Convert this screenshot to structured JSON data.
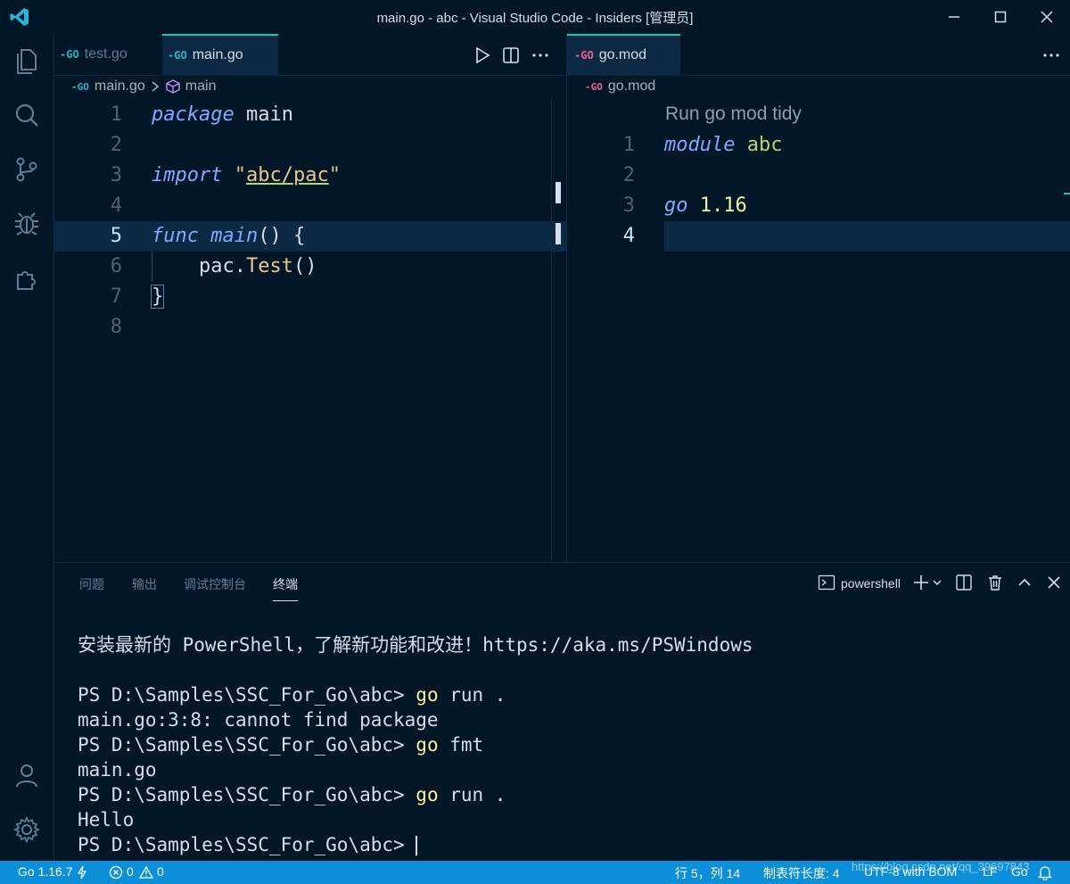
{
  "window": {
    "title": "main.go - abc - Visual Studio Code - Insiders [管理员]"
  },
  "left_editor": {
    "tabs": [
      {
        "icon": "-GO",
        "label": "test.go"
      },
      {
        "icon": "-GO",
        "label": "main.go"
      }
    ],
    "breadcrumb": {
      "file": "main.go",
      "symbol": "main"
    },
    "line_numbers": [
      "1",
      "2",
      "3",
      "4",
      "5",
      "6",
      "7",
      "8"
    ],
    "code": {
      "l1_kw": "package",
      "l1_rest": " main",
      "l3_kw": "import",
      "l3_q1": " \"",
      "l3_path": "abc/pac",
      "l3_q2": "\"",
      "l5_kw": "func",
      "l5_fn": " main",
      "l5_rest": "() {",
      "l6_obj": "    pac.",
      "l6_fn": "Test",
      "l6_rest": "()",
      "l7": "}"
    }
  },
  "right_editor": {
    "tabs": [
      {
        "icon": "-GO",
        "label": "go.mod"
      }
    ],
    "breadcrumb": {
      "file": "go.mod"
    },
    "codelens": "Run go mod tidy",
    "line_numbers": [
      "1",
      "2",
      "3",
      "4"
    ],
    "code": {
      "l1_kw": "module",
      "l1_rest": " abc",
      "l3_kw": "go",
      "l3_rest": " 1.16"
    }
  },
  "panel": {
    "tabs": [
      "问题",
      "输出",
      "调试控制台",
      "终端"
    ],
    "terminal_name": "powershell",
    "terminal_lines": [
      {
        "text": "安装最新的 PowerShell，了解新功能和改进！https://aka.ms/PSWindows"
      },
      {
        "text": ""
      },
      {
        "prompt": "PS D:\\Samples\\SSC_For_Go\\abc> ",
        "cmd": "go",
        "args": " run ."
      },
      {
        "text": "main.go:3:8: cannot find package"
      },
      {
        "prompt": "PS D:\\Samples\\SSC_For_Go\\abc> ",
        "cmd": "go",
        "args": " fmt"
      },
      {
        "text": "main.go"
      },
      {
        "prompt": "PS D:\\Samples\\SSC_For_Go\\abc> ",
        "cmd": "go",
        "args": " run ."
      },
      {
        "text": "Hello"
      },
      {
        "prompt": "PS D:\\Samples\\SSC_For_Go\\abc> ",
        "cmd": "",
        "args": ""
      }
    ]
  },
  "statusbar": {
    "go_version": "Go 1.16.7",
    "errors": "0",
    "warnings": "0",
    "position": "行 5，列 14",
    "indent": "制表符长度: 4",
    "encoding": "UTF-8 with BOM",
    "eol": "LF",
    "language": "Go",
    "watermark": "https://blog.csdn.net/qq_39697843"
  },
  "colors": {
    "background": "#011627",
    "accent": "#21c7a8",
    "statusbar": "#0b8fd8"
  }
}
